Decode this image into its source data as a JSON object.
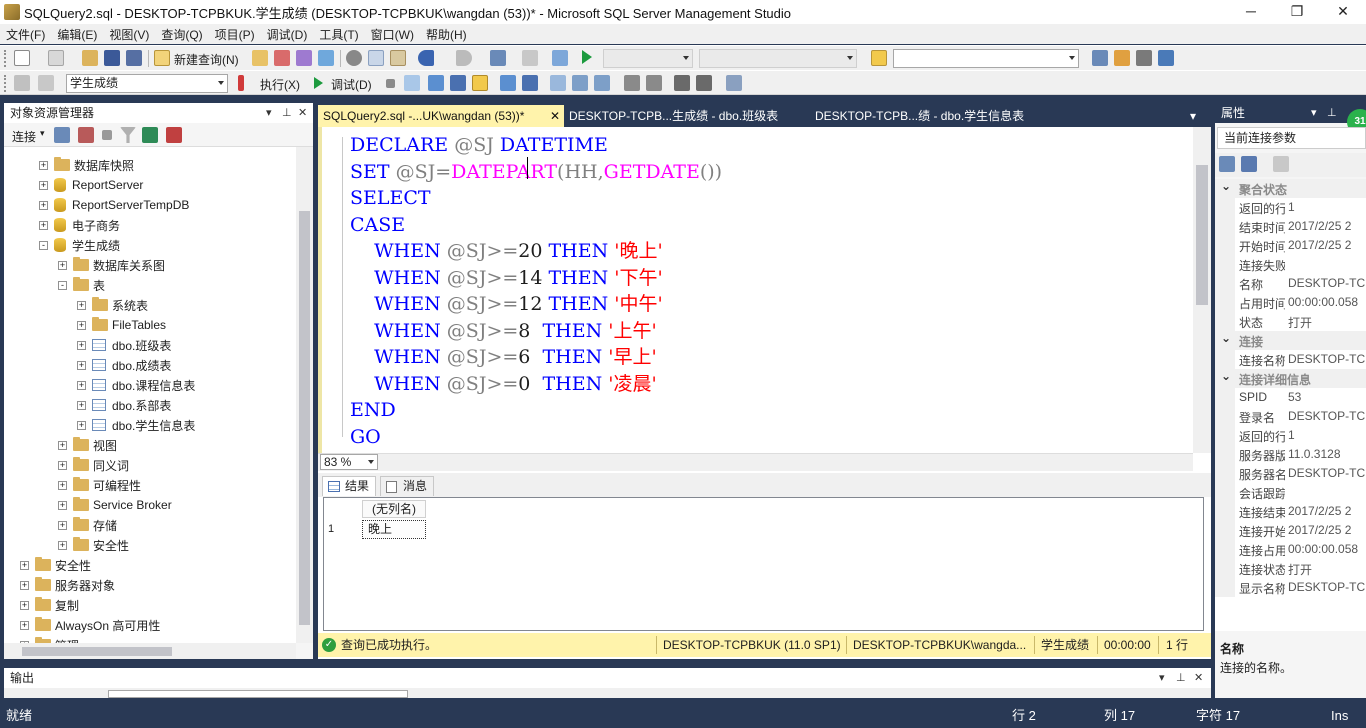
{
  "window": {
    "title": "SQLQuery2.sql - DESKTOP-TCPBKUK.学生成绩 (DESKTOP-TCPBKUK\\wangdan (53))* - Microsoft SQL Server Management Studio",
    "minimize": "─",
    "maximize": "❐",
    "close": "✕"
  },
  "menu": [
    "文件(F)",
    "编辑(E)",
    "视图(V)",
    "查询(Q)",
    "项目(P)",
    "调试(D)",
    "工具(T)",
    "窗口(W)",
    "帮助(H)"
  ],
  "toolbar": {
    "new_query": "新建查询(N)",
    "database": "学生成绩",
    "execute": "执行(X)",
    "debug": "调试(D)"
  },
  "object_explorer": {
    "title": "对象资源管理器",
    "connect": "连接",
    "tree": [
      {
        "label": "数据库快照",
        "icon": "folder",
        "level": 2,
        "exp": "+"
      },
      {
        "label": "ReportServer",
        "icon": "database",
        "level": 2,
        "exp": "+"
      },
      {
        "label": "ReportServerTempDB",
        "icon": "database",
        "level": 2,
        "exp": "+"
      },
      {
        "label": "电子商务",
        "icon": "database",
        "level": 2,
        "exp": "+"
      },
      {
        "label": "学生成绩",
        "icon": "database",
        "level": 2,
        "exp": "-"
      },
      {
        "label": "数据库关系图",
        "icon": "folder",
        "level": 3,
        "exp": "+"
      },
      {
        "label": "表",
        "icon": "folder",
        "level": 3,
        "exp": "-"
      },
      {
        "label": "系统表",
        "icon": "folder",
        "level": 4,
        "exp": "+"
      },
      {
        "label": "FileTables",
        "icon": "folder",
        "level": 4,
        "exp": "+"
      },
      {
        "label": "dbo.班级表",
        "icon": "table",
        "level": 4,
        "exp": "+"
      },
      {
        "label": "dbo.成绩表",
        "icon": "table",
        "level": 4,
        "exp": "+"
      },
      {
        "label": "dbo.课程信息表",
        "icon": "table",
        "level": 4,
        "exp": "+"
      },
      {
        "label": "dbo.系部表",
        "icon": "table",
        "level": 4,
        "exp": "+"
      },
      {
        "label": "dbo.学生信息表",
        "icon": "table",
        "level": 4,
        "exp": "+"
      },
      {
        "label": "视图",
        "icon": "folder",
        "level": 3,
        "exp": "+"
      },
      {
        "label": "同义词",
        "icon": "folder",
        "level": 3,
        "exp": "+"
      },
      {
        "label": "可编程性",
        "icon": "folder",
        "level": 3,
        "exp": "+"
      },
      {
        "label": "Service Broker",
        "icon": "folder",
        "level": 3,
        "exp": "+"
      },
      {
        "label": "存储",
        "icon": "folder",
        "level": 3,
        "exp": "+"
      },
      {
        "label": "安全性",
        "icon": "folder",
        "level": 3,
        "exp": "+"
      },
      {
        "label": "安全性",
        "icon": "folder",
        "level": 1,
        "exp": "+"
      },
      {
        "label": "服务器对象",
        "icon": "folder",
        "level": 1,
        "exp": "+"
      },
      {
        "label": "复制",
        "icon": "folder",
        "level": 1,
        "exp": "+"
      },
      {
        "label": "AlwaysOn 高可用性",
        "icon": "folder",
        "level": 1,
        "exp": "+"
      },
      {
        "label": "管理",
        "icon": "folder",
        "level": 1,
        "exp": "+"
      }
    ]
  },
  "editor": {
    "tabs": [
      {
        "label": "SQLQuery2.sql -...UK\\wangdan (53))*",
        "active": true,
        "close": "✕"
      },
      {
        "label": "DESKTOP-TCPB...生成绩 - dbo.班级表",
        "active": false
      },
      {
        "label": "DESKTOP-TCPB...绩 - dbo.学生信息表",
        "active": false
      }
    ],
    "zoom": "83 %"
  },
  "results": {
    "tab_results": "结果",
    "tab_messages": "消息",
    "column_header": "(无列名)",
    "row_number": "1",
    "cell_value": "晚上"
  },
  "query_status": {
    "message": "查询已成功执行。",
    "server": "DESKTOP-TCPBKUK (11.0 SP1)",
    "user": "DESKTOP-TCPBKUK\\wangda...",
    "database": "学生成绩",
    "elapsed": "00:00:00",
    "rows": "1 行"
  },
  "properties": {
    "title": "属性",
    "selector": "当前连接参数",
    "badge": "31",
    "categories": [
      {
        "name": "聚合状态",
        "rows": [
          {
            "name": "返回的行",
            "value": "1"
          },
          {
            "name": "结束时间",
            "value": "2017/2/25 2"
          },
          {
            "name": "开始时间",
            "value": "2017/2/25 2"
          },
          {
            "name": "连接失败",
            "value": ""
          },
          {
            "name": "名称",
            "value": "DESKTOP-TC"
          },
          {
            "name": "占用时间",
            "value": "00:00:00.058"
          },
          {
            "name": "状态",
            "value": "打开"
          }
        ]
      },
      {
        "name": "连接",
        "rows": [
          {
            "name": "连接名称",
            "value": "DESKTOP-TC"
          }
        ]
      },
      {
        "name": "连接详细信息",
        "rows": [
          {
            "name": "SPID",
            "value": "53"
          },
          {
            "name": "登录名",
            "value": "DESKTOP-TC"
          },
          {
            "name": "返回的行",
            "value": "1"
          },
          {
            "name": "服务器版本",
            "value": "11.0.3128"
          },
          {
            "name": "服务器名称",
            "value": "DESKTOP-TC"
          },
          {
            "name": "会话跟踪",
            "value": ""
          },
          {
            "name": "连接结束",
            "value": "2017/2/25 2"
          },
          {
            "name": "连接开始",
            "value": "2017/2/25 2"
          },
          {
            "name": "连接占用",
            "value": "00:00:00.058"
          },
          {
            "name": "连接状态",
            "value": "打开"
          },
          {
            "name": "显示名称",
            "value": "DESKTOP-TC"
          }
        ]
      }
    ],
    "desc_title": "名称",
    "desc_text": "连接的名称。"
  },
  "output": {
    "title": "输出"
  },
  "statusbar": {
    "ready": "就绪",
    "line": "行 2",
    "col": "列 17",
    "char": "字符 17",
    "mode": "Ins"
  },
  "code_lines": [
    [
      {
        "t": "DECLARE ",
        "c": "kw"
      },
      {
        "t": "@SJ ",
        "c": "op"
      },
      {
        "t": "DATETIME",
        "c": "kw"
      }
    ],
    [
      {
        "t": "SET ",
        "c": "kw"
      },
      {
        "t": "@SJ",
        "c": "op"
      },
      {
        "t": "=",
        "c": "op"
      },
      {
        "t": "DATEPART",
        "c": "fn"
      },
      {
        "t": "(",
        "c": "op"
      },
      {
        "t": "HH",
        "c": "op"
      },
      {
        "t": ",",
        "c": "op"
      },
      {
        "t": "GETDATE",
        "c": "fn"
      },
      {
        "t": "())",
        "c": "op"
      }
    ],
    [
      {
        "t": "SELECT",
        "c": "kw"
      }
    ],
    [
      {
        "t": "CASE",
        "c": "kw"
      }
    ],
    [
      {
        "t": "    WHEN ",
        "c": "kw"
      },
      {
        "t": "@SJ",
        "c": "op"
      },
      {
        "t": ">=",
        "c": "op"
      },
      {
        "t": "20 ",
        "c": "var"
      },
      {
        "t": "THEN ",
        "c": "kw"
      },
      {
        "t": "'晚上'",
        "c": "str"
      }
    ],
    [
      {
        "t": "    WHEN ",
        "c": "kw"
      },
      {
        "t": "@SJ",
        "c": "op"
      },
      {
        "t": ">=",
        "c": "op"
      },
      {
        "t": "14 ",
        "c": "var"
      },
      {
        "t": "THEN ",
        "c": "kw"
      },
      {
        "t": "'下午'",
        "c": "str"
      }
    ],
    [
      {
        "t": "    WHEN ",
        "c": "kw"
      },
      {
        "t": "@SJ",
        "c": "op"
      },
      {
        "t": ">=",
        "c": "op"
      },
      {
        "t": "12 ",
        "c": "var"
      },
      {
        "t": "THEN ",
        "c": "kw"
      },
      {
        "t": "'中午'",
        "c": "str"
      }
    ],
    [
      {
        "t": "    WHEN ",
        "c": "kw"
      },
      {
        "t": "@SJ",
        "c": "op"
      },
      {
        "t": ">=",
        "c": "op"
      },
      {
        "t": "8  ",
        "c": "var"
      },
      {
        "t": "THEN ",
        "c": "kw"
      },
      {
        "t": "'上午'",
        "c": "str"
      }
    ],
    [
      {
        "t": "    WHEN ",
        "c": "kw"
      },
      {
        "t": "@SJ",
        "c": "op"
      },
      {
        "t": ">=",
        "c": "op"
      },
      {
        "t": "6  ",
        "c": "var"
      },
      {
        "t": "THEN ",
        "c": "kw"
      },
      {
        "t": "'早上'",
        "c": "str"
      }
    ],
    [
      {
        "t": "    WHEN ",
        "c": "kw"
      },
      {
        "t": "@SJ",
        "c": "op"
      },
      {
        "t": ">=",
        "c": "op"
      },
      {
        "t": "0  ",
        "c": "var"
      },
      {
        "t": "THEN ",
        "c": "kw"
      },
      {
        "t": "'凌晨'",
        "c": "str"
      }
    ],
    [
      {
        "t": "END",
        "c": "kw"
      }
    ],
    [
      {
        "t": "GO",
        "c": "kw"
      }
    ]
  ]
}
